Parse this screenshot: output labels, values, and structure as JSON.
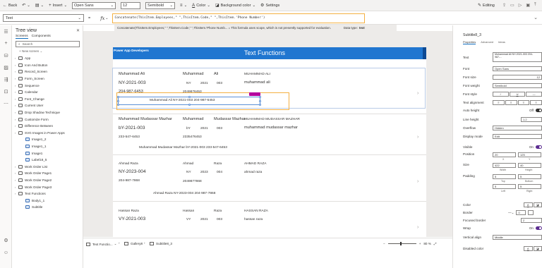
{
  "toolbar": {
    "back": "Back",
    "insert": "Insert",
    "font": "Open Sans",
    "size": "12",
    "weight": "Semibold",
    "color": "Color",
    "background": "Background color",
    "settings": "Settings",
    "editing": "Editing"
  },
  "formula": {
    "property": "Text",
    "fx": "fx",
    "text": "Concatenate(ThisItem.Employees,\"   \",ThisItem.Code,\"      \",ThisItem.'Phone Number')",
    "hint": "Concatenate(ThisItem.Employees,\" \",ThisItem.Code,\" \",ThisItem.'Phone Numb... = This formula uses scope, which is not presently supported for evaluation.",
    "datatype_label": "Data type:",
    "datatype_value": "text"
  },
  "tree": {
    "title": "Tree view",
    "tab_screens": "Screens",
    "tab_components": "Components",
    "search_placeholder": "Search",
    "new_screen": "New screen",
    "items": [
      {
        "label": "App"
      },
      {
        "label": "Icon And Button"
      },
      {
        "label": "Record_Screen"
      },
      {
        "label": "Form_Screen"
      },
      {
        "label": "Sequence"
      },
      {
        "label": "Calendar"
      },
      {
        "label": "Font_Change"
      },
      {
        "label": "Current User"
      },
      {
        "label": "Drop Shadow Technique"
      },
      {
        "label": "Customize Form"
      },
      {
        "label": "Difference Between"
      },
      {
        "label": "SVG Images in Power Apps"
      },
      {
        "label": "Image1_2"
      },
      {
        "label": "Image1_1"
      },
      {
        "label": "Image1"
      },
      {
        "label": "Label16_5"
      },
      {
        "label": "Work Order List"
      },
      {
        "label": "Work Order Page1"
      },
      {
        "label": "Work Order Page2"
      },
      {
        "label": "Work Order Page3"
      },
      {
        "label": "Text Functions"
      },
      {
        "label": "Body1_1"
      },
      {
        "label": "Subtitle"
      }
    ]
  },
  "screen": {
    "brand": "Power App Developers",
    "title": "Text Functions"
  },
  "records": [
    {
      "name": "Muhammad Ali",
      "first": "Muhammad",
      "last": "Ali",
      "upper": "MUHAMMAD ALI",
      "code": "NY-2021-003",
      "code_prefix": "NY",
      "code_year": "2021",
      "code_num": "003",
      "lower": "muhammad ali",
      "phone": "204-987-6453",
      "digits": "2049876453",
      "concat": "Muhammad Ali  NY-2021-003   204-987-6453"
    },
    {
      "name": "Muhammad Mudassar Mazhar",
      "first": "Muhammad",
      "last": "Mudassar Mazhar",
      "upper": "MUHAMMAD MUDASSAR MAZHAR",
      "code": "bY-2021-003",
      "code_prefix": "bY",
      "code_year": "2021",
      "code_num": "003",
      "lower": "muhammad mudassar mazhar",
      "phone": "233-547-6453",
      "digits": "2335476453",
      "concat": "Muhammad Mudassar Mazhar  bY-2021-003   233-547-6453"
    },
    {
      "name": "Ahmad Raza",
      "first": "Ahmad",
      "last": "Raza",
      "upper": "AHMAD RAZA",
      "code": "NY-2023-004",
      "code_prefix": "NY",
      "code_year": "2023",
      "code_num": "004",
      "lower": "ahmad raza",
      "phone": "204-987-7868",
      "digits": "2049877868",
      "concat": "Ahmad Raza  NY-2023-004   204-987-7868"
    },
    {
      "name": "Hassan Raza",
      "first": "Hassan",
      "last": "Raza",
      "upper": "HASSAN RAZA",
      "code": "VY-2021-003",
      "code_prefix": "VY",
      "code_year": "2021",
      "code_num": "003",
      "lower": "hassan raza",
      "phone": "",
      "digits": "",
      "concat": ""
    }
  ],
  "status": {
    "tab1": "Text Functio...",
    "tab2": "Gallery8",
    "tab3": "Subtitle8_3",
    "zoom": "80 %"
  },
  "props": {
    "control": "Subtitle8_3",
    "tabs": [
      "Properties",
      "Advanced",
      "Ideas"
    ],
    "text_label": "Text",
    "text_value": "Muhammad Ali  NY-2021-003  204-987-...",
    "font_label": "Font",
    "font_value": "Open Sans",
    "fontsize_label": "Font size",
    "fontsize_value": "12",
    "fontweight_label": "Font weight",
    "fontweight_value": "Semibold",
    "fontstyle_label": "Font style",
    "textalign_label": "Text alignment",
    "autoheight_label": "Auto height",
    "autoheight_value": "Off",
    "lineheight_label": "Line height",
    "lineheight_value": "1.2",
    "overflow_label": "Overflow",
    "overflow_value": "Hidden",
    "displaymode_label": "Display mode",
    "displaymode_value": "Edit",
    "visible_label": "Visible",
    "visible_value": "On",
    "position_label": "Position",
    "pos_x": "20",
    "pos_y": "125",
    "size_label": "Size",
    "size_w": "422",
    "size_h": "40",
    "padding_label": "Padding",
    "pad_top": "5",
    "pad_bottom": "5",
    "pad_left": "5",
    "pad_right": "5",
    "color_label": "Color",
    "border_label": "Border",
    "border_value": "0",
    "focused_label": "Focused border",
    "focused_value": "2",
    "wrap_label": "Wrap",
    "wrap_value": "On",
    "valign_label": "Vertical align",
    "valign_value": "Middle",
    "disabled_label": "Disabled color",
    "cap_x": "X",
    "cap_y": "Y",
    "cap_w": "Width",
    "cap_h": "Height",
    "cap_top": "Top",
    "cap_bottom": "Bottom",
    "cap_left": "Left",
    "cap_right": "Right"
  }
}
